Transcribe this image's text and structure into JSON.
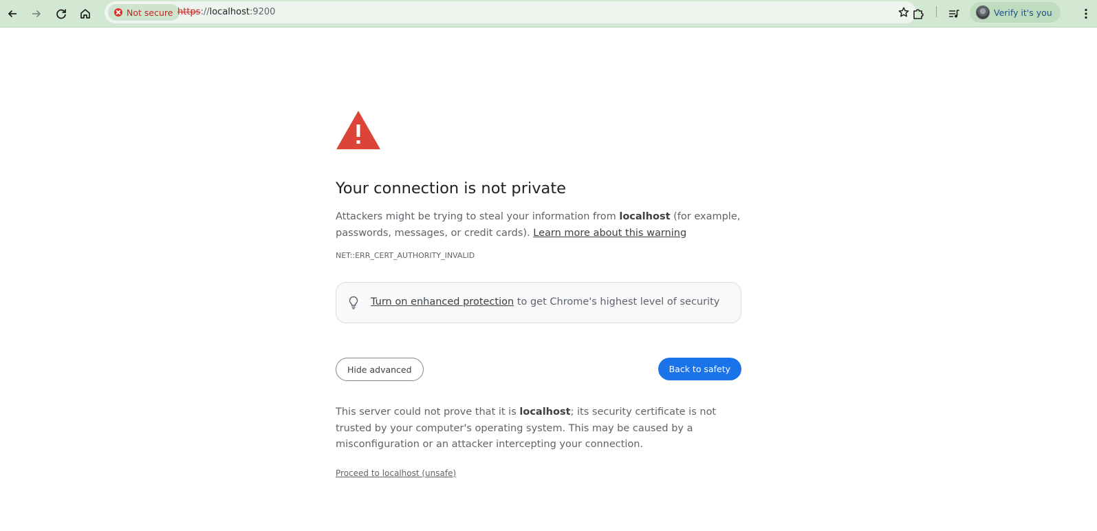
{
  "browser": {
    "security_chip": "Not secure",
    "url_scheme": "https",
    "url_sep": "://",
    "url_host": "localhost",
    "url_port": ":9200",
    "profile_label": "Verify it's you",
    "icons": [
      "back-arrow-icon",
      "forward-arrow-icon",
      "reload-icon",
      "home-icon",
      "star-icon",
      "extensions-icon",
      "media-queue-icon",
      "avatar",
      "menu-kebab-icon"
    ]
  },
  "interstitial": {
    "heading": "Your connection is not private",
    "message_prefix": "Attackers might be trying to steal your information from ",
    "message_host": "localhost",
    "message_suffix": " (for example, passwords, messages, or credit cards). ",
    "learn_more": "Learn more about this warning",
    "error_code": "NET::ERR_CERT_AUTHORITY_INVALID",
    "protection_link": "Turn on enhanced protection",
    "protection_suffix": " to get Chrome's highest level of security",
    "hide_advanced": "Hide advanced",
    "back_to_safety": "Back to safety",
    "detail_prefix": "This server could not prove that it is ",
    "detail_host": "localhost",
    "detail_suffix": "; its security certificate is not trusted by your computer's operating system. This may be caused by a misconfiguration or an attacker intercepting your connection.",
    "proceed_link": "Proceed to localhost (unsafe)"
  },
  "colors": {
    "toolbar_bg": "#d3e8d3",
    "warning_red": "#db4437",
    "primary_blue": "#1a73e8",
    "insecure_red": "#c5221f"
  }
}
